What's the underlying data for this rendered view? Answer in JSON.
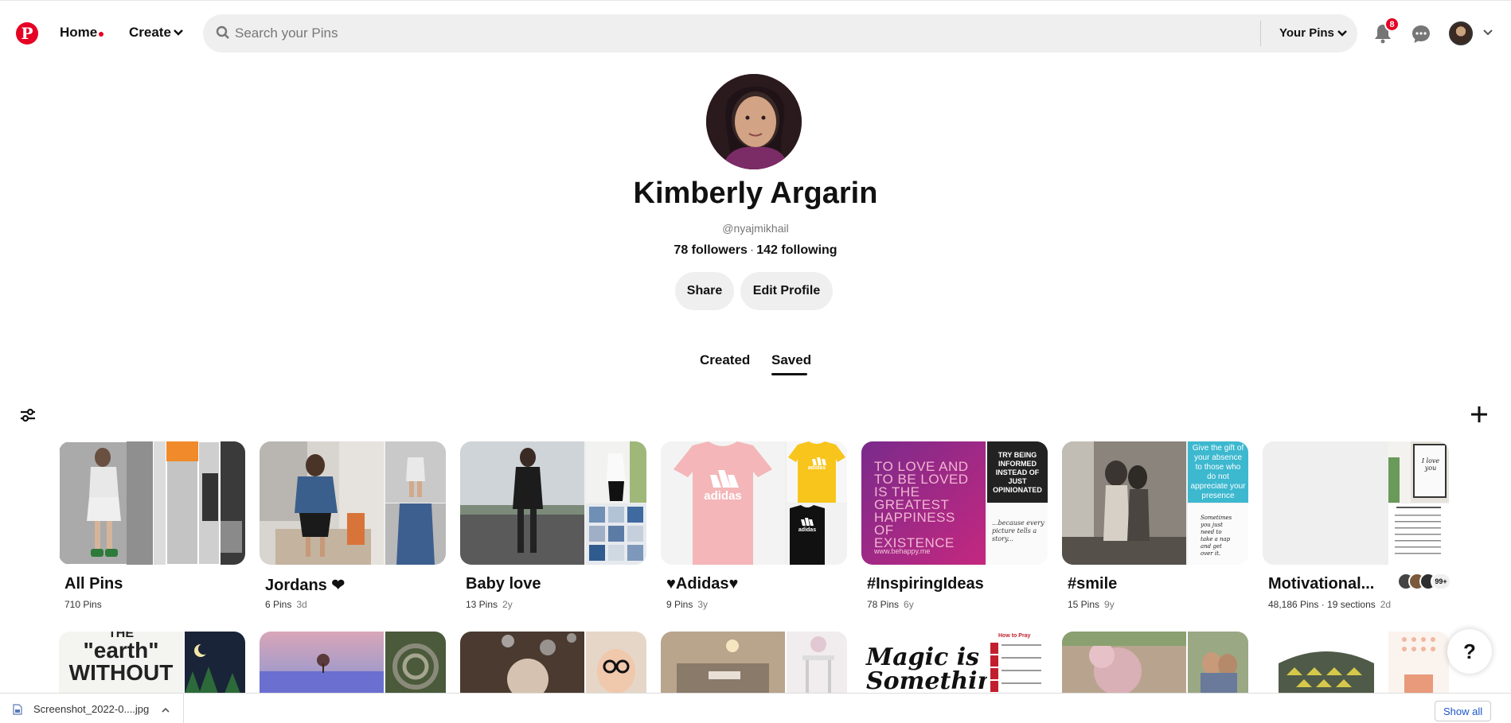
{
  "header": {
    "logo_icon": "pinterest-logo-icon",
    "home_label": "Home",
    "create_label": "Create",
    "search_placeholder": "Search your Pins",
    "search_scope_label": "Your Pins",
    "notification_count": "8",
    "brand_color": "#e60023"
  },
  "profile": {
    "name": "Kimberly Argarin",
    "handle": "@nyajmikhail",
    "followers": "78 followers",
    "separator": "·",
    "following": "142 following",
    "share_label": "Share",
    "edit_label": "Edit Profile"
  },
  "tabs": {
    "created": "Created",
    "saved": "Saved",
    "active": "Saved"
  },
  "boards": [
    {
      "title": "All Pins",
      "count": "710 Pins",
      "age": ""
    },
    {
      "title": "Jordans ❤",
      "count": "6 Pins",
      "age": "3d"
    },
    {
      "title": "Baby love",
      "count": "13 Pins",
      "age": "2y"
    },
    {
      "title": "♥Adidas♥",
      "count": "9 Pins",
      "age": "3y"
    },
    {
      "title": "#InspiringIdeas",
      "count": "78 Pins",
      "age": "6y"
    },
    {
      "title": "#smile",
      "count": "15 Pins",
      "age": "9y"
    },
    {
      "title": "Motivational...",
      "count": "48,186 Pins · 19 sections",
      "age": "2d",
      "collaborators_more": "99+"
    }
  ],
  "cover_text": {
    "adidas_main": "adidas",
    "adidas_tr": "adidas",
    "adidas_br": "adidas",
    "inspiring_main": "TO LOVE AND TO BE LOVED IS THE GREATEST HAPPINESS OF EXISTENCE",
    "inspiring_site": "www.behappy.me",
    "inspiring_tr": "TRY BEING INFORMED INSTEAD OF JUST OPINIONATED",
    "inspiring_br": "...because every picture tells a story...",
    "smile_tr": "Give the gift of your absence to those who do not appreciate your presence",
    "smile_br": "Sometimes you just need to take a nap and get over it.",
    "motivational_tr": "I love you",
    "row2_earth": "\"earth\" WITHOUT",
    "row2_earth_top": "THE",
    "row2_magic": "Magic is Something",
    "row2_pray": "How to Pray"
  },
  "help_label": "?",
  "download_bar": {
    "file_name": "Screenshot_2022-0....jpg",
    "show_all_label": "Show all"
  }
}
